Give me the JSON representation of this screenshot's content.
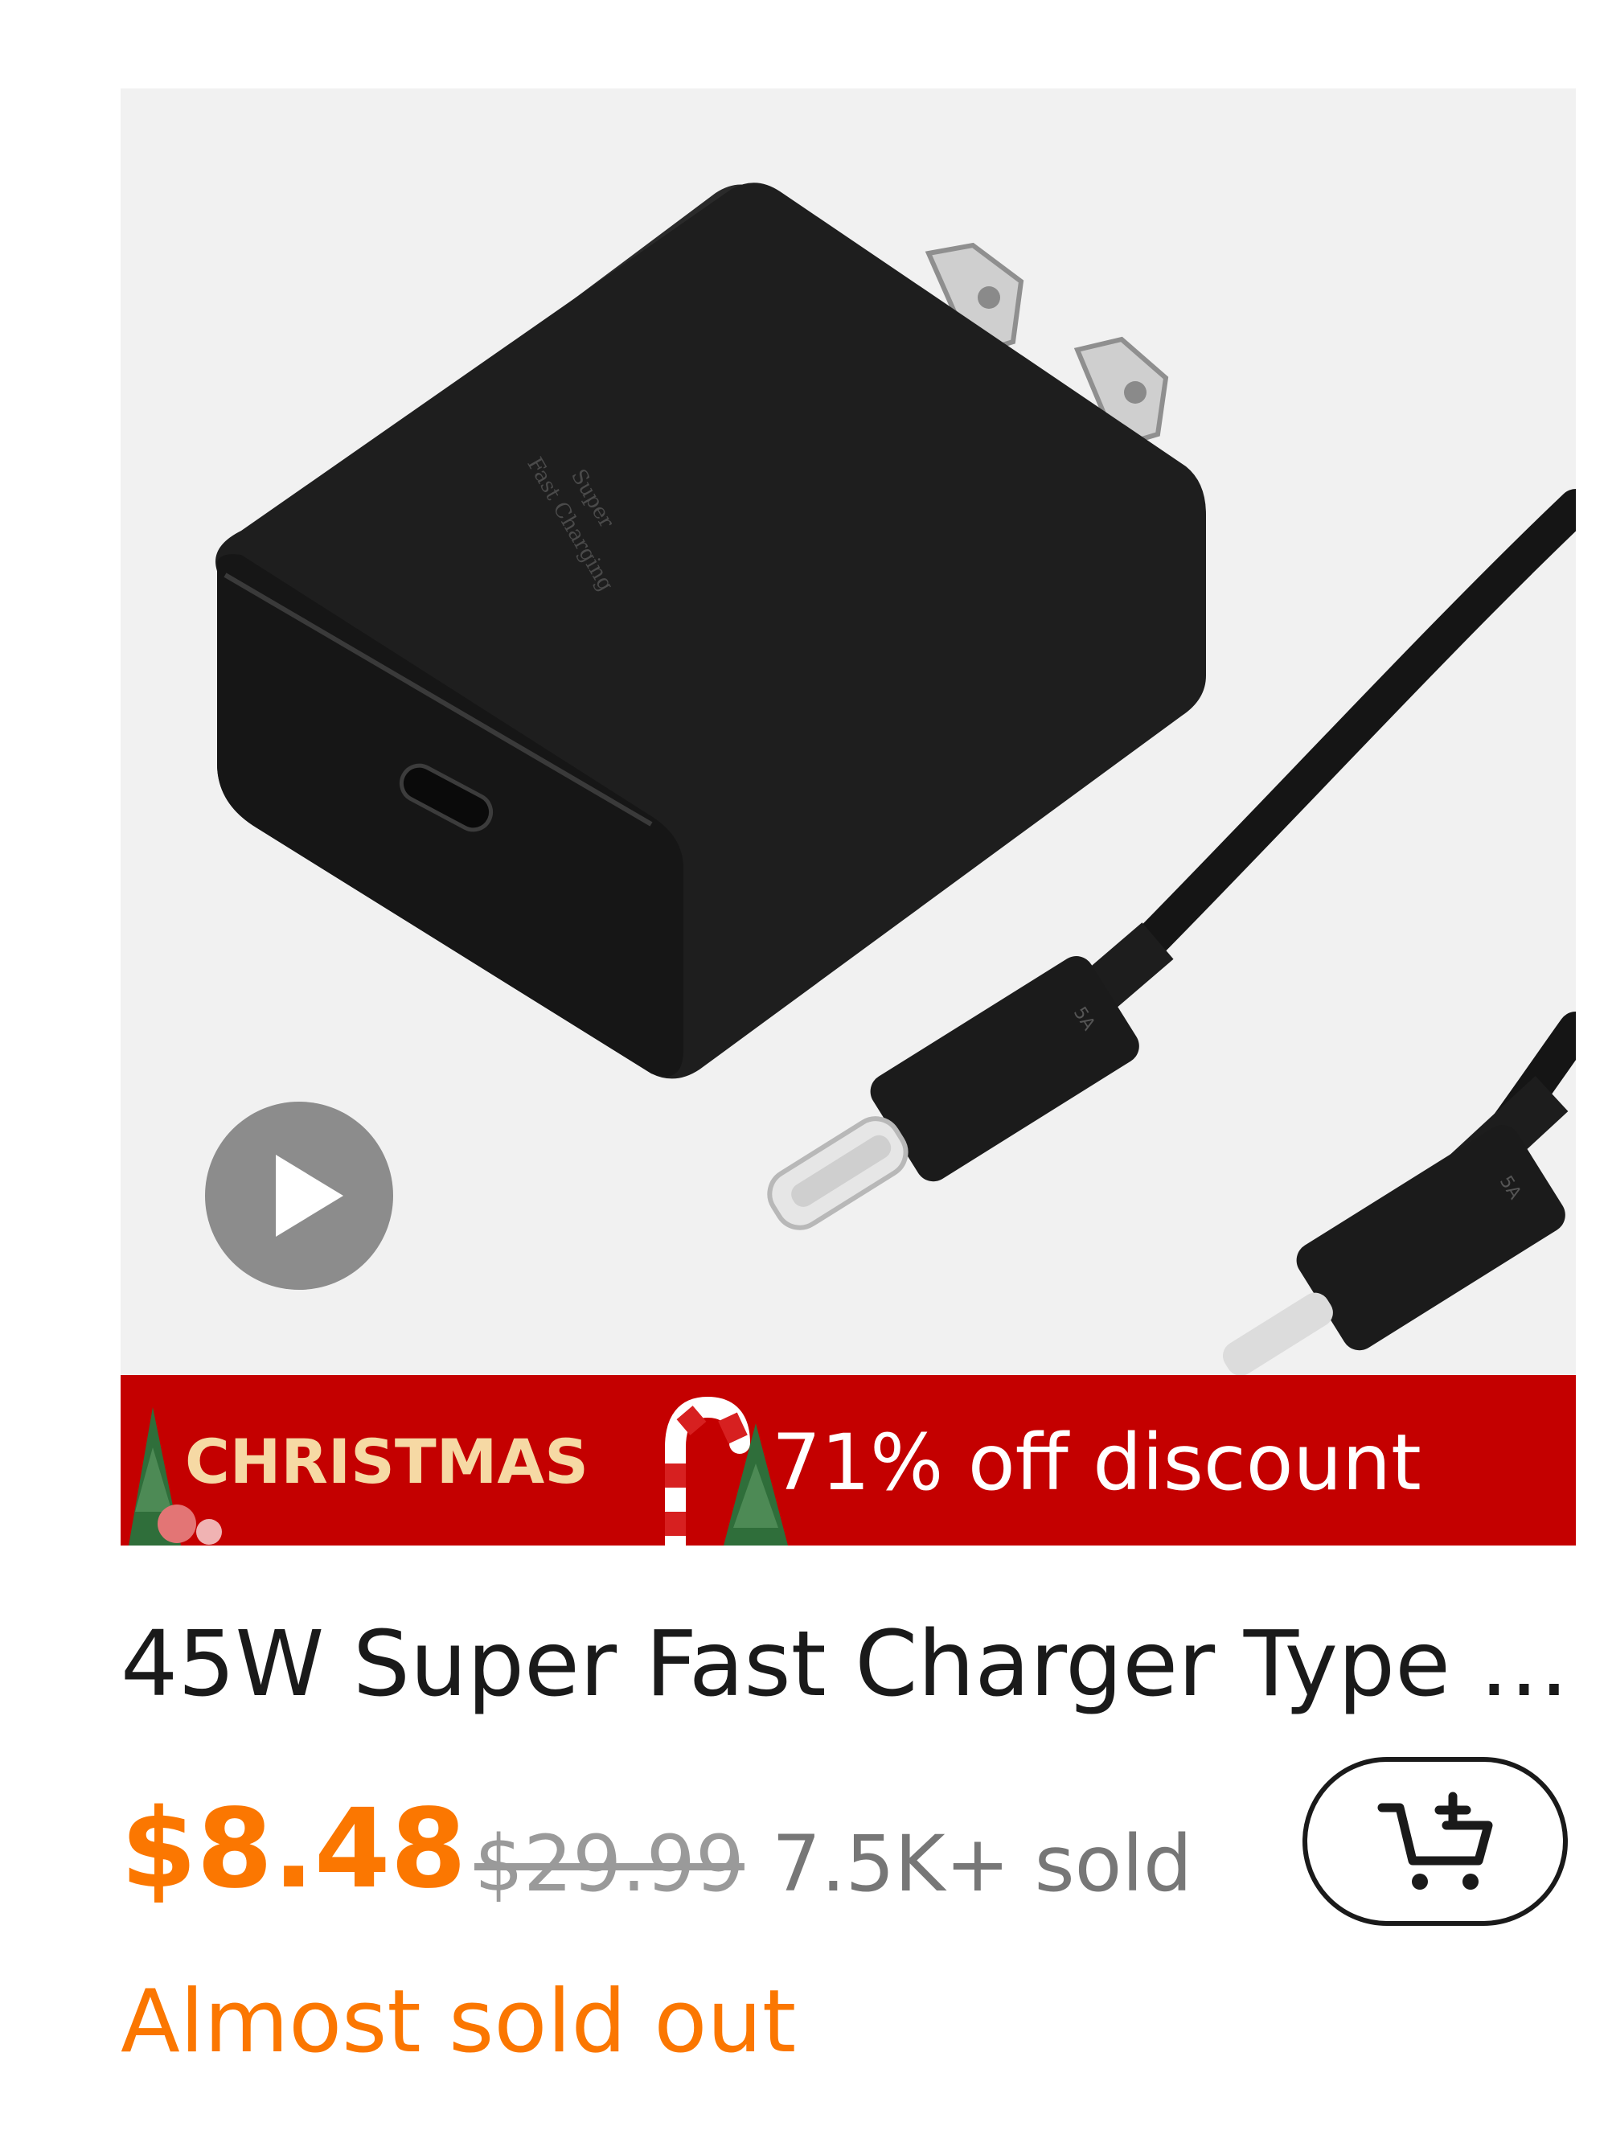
{
  "product": {
    "image_icon": "charger-and-cable-image",
    "video_icon": "play-icon",
    "charger_print_line1": "Super",
    "charger_print_line2": "Fast Charging",
    "cable_marking": "5A",
    "title": "45W Super Fast Charger Type C,...",
    "price": "$8.48",
    "original_price": "$29.99",
    "sold_count": "7.5K+ sold",
    "stock_status": "Almost sold out"
  },
  "promo": {
    "tag": "CHRISTMAS",
    "discount_text": "71% off discount"
  },
  "cart": {
    "icon": "add-to-cart-icon"
  },
  "colors": {
    "accent_orange": "#fb7701",
    "banner_red": "#c40000",
    "banner_gold_text": "#f6d9a4"
  }
}
